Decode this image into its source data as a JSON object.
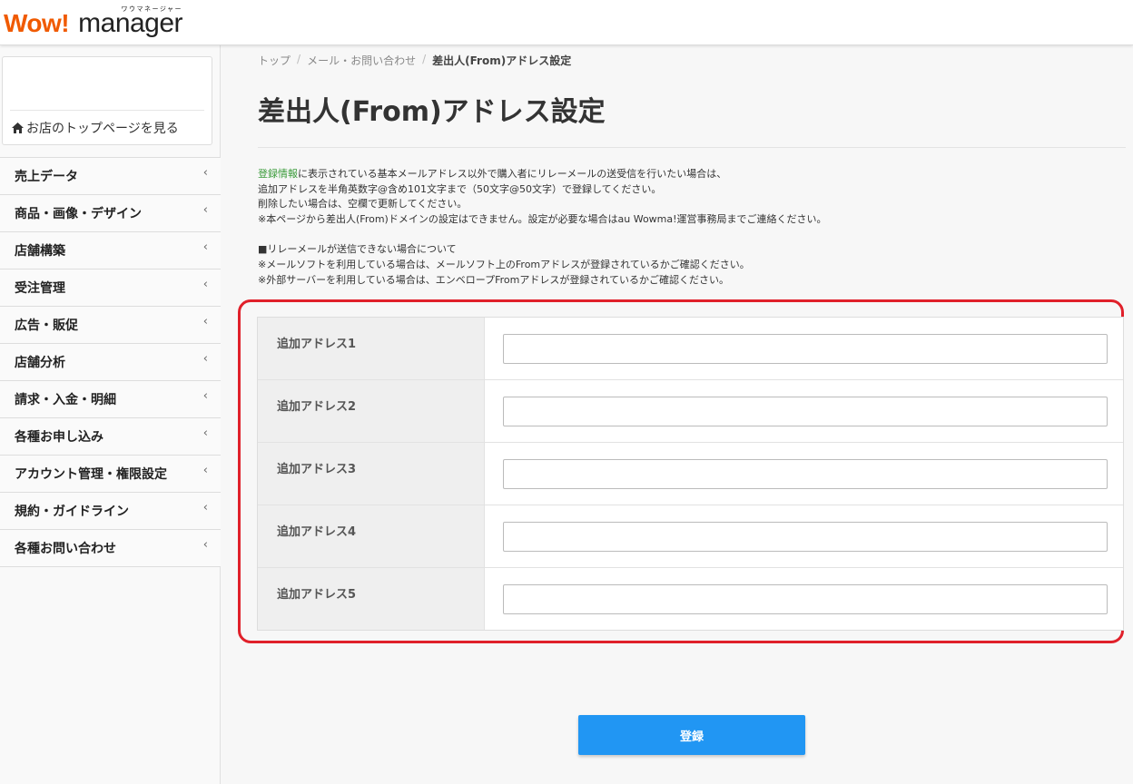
{
  "header": {
    "logo_wow": "Wow!",
    "logo_manager": "manager",
    "logo_ruby": "ワウマネージャー"
  },
  "sidebar": {
    "shop_link": "お店のトップページを見る",
    "items": [
      {
        "label": "売上データ"
      },
      {
        "label": "商品・画像・デザイン"
      },
      {
        "label": "店舗構築"
      },
      {
        "label": "受注管理"
      },
      {
        "label": "広告・販促"
      },
      {
        "label": "店舗分析"
      },
      {
        "label": "請求・入金・明細"
      },
      {
        "label": "各種お申し込み"
      },
      {
        "label": "アカウント管理・権限設定"
      },
      {
        "label": "規約・ガイドライン"
      },
      {
        "label": "各種お問い合わせ"
      }
    ],
    "chevron": "‹"
  },
  "breadcrumb": {
    "items": [
      "トップ",
      "メール・お問い合わせ"
    ],
    "current": "差出人(From)アドレス設定",
    "separator": "/"
  },
  "page": {
    "title": "差出人(From)アドレス設定"
  },
  "description": {
    "link": "登録情報",
    "line1_rest": "に表示されている基本メールアドレス以外で購入者にリレーメールの送受信を行いたい場合は、",
    "line2": "追加アドレスを半角英数字@含め101文字まで（50文字@50文字）で登録してください。",
    "line3": "削除したい場合は、空欄で更新してください。",
    "line4": "※本ページから差出人(From)ドメインの設定はできません。設定が必要な場合はau Wowma!運営事務局までご連絡ください。",
    "line5": "■リレーメールが送信できない場合について",
    "line6": "※メールソフトを利用している場合は、メールソフト上のFromアドレスが登録されているかご確認ください。",
    "line7": "※外部サーバーを利用している場合は、エンベロープFromアドレスが登録されているかご確認ください。"
  },
  "form": {
    "rows": [
      {
        "label": "追加アドレス1",
        "value": ""
      },
      {
        "label": "追加アドレス2",
        "value": ""
      },
      {
        "label": "追加アドレス3",
        "value": ""
      },
      {
        "label": "追加アドレス4",
        "value": ""
      },
      {
        "label": "追加アドレス5",
        "value": ""
      }
    ],
    "submit_label": "登録"
  },
  "colors": {
    "brand_orange": "#f05a00",
    "primary_button": "#2196f3",
    "highlight_border": "#e0202a",
    "link_green": "#3a9b3a"
  }
}
